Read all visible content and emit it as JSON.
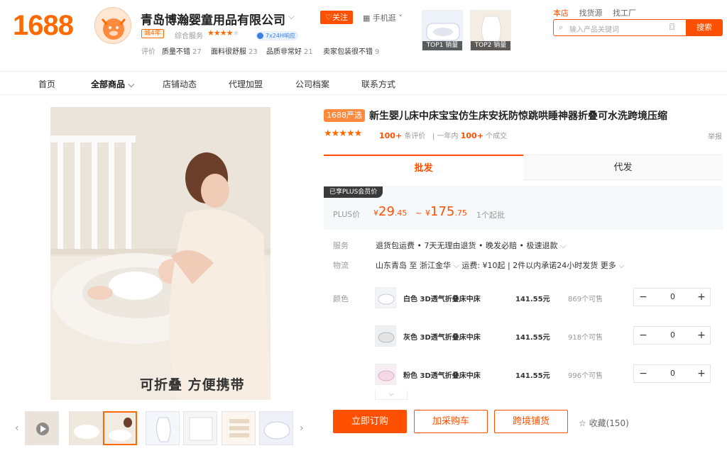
{
  "header": {
    "logo": "1688",
    "shop_name": "青岛博瀚婴童用品有限公司",
    "follow": "关注",
    "mobile": "手机逛",
    "years_badge": "诚4年",
    "service_label": "综合服务",
    "service_rating_stars": 4,
    "response_badge": "7x24H响应",
    "review_label": "评价",
    "review_tags": [
      {
        "label": "质量不错",
        "count": "27"
      },
      {
        "label": "面料很舒服",
        "count": "23"
      },
      {
        "label": "品质非常好",
        "count": "21"
      },
      {
        "label": "卖家包装很不错",
        "count": "9"
      }
    ],
    "top_products": [
      {
        "label": "TOP1 销量"
      },
      {
        "label": "TOP2 销量"
      }
    ],
    "links": [
      "本店",
      "找货源",
      "找工厂"
    ],
    "search_placeholder": "输入产品关键词",
    "search_button": "搜索"
  },
  "nav": {
    "items": [
      "首页",
      "全部商品",
      "店铺动态",
      "代理加盟",
      "公司档案",
      "联系方式"
    ]
  },
  "gallery": {
    "caption": "可折叠 方便携带",
    "thumbnail_count": 7,
    "selected_index": 2
  },
  "product": {
    "badge": "1688严选",
    "title": "新生婴儿床中床宝宝仿生床安抚防惊跳哄睡神器折叠可水洗跨境压缩",
    "review_count": "100+",
    "review_suffix": "条评价",
    "year_prefix": "一年内",
    "deals": "100+",
    "deals_suffix": "个成交",
    "report": "举报",
    "tabs": [
      "批发",
      "代发"
    ],
    "active_tab": 0,
    "plus_tag": "已享PLUS会员价",
    "plus_label": "PLUS价",
    "price_low_int": "29",
    "price_low_dec": ".45",
    "price_high_int": "175",
    "price_high_dec": ".75",
    "currency": "¥",
    "price_sep": "~",
    "moq": "1个起批",
    "service_label": "服务",
    "service_text": "退货包运费 • 7天无理由退货 • 晚发必赔 • 极速退款",
    "logistics_label": "物流",
    "logistics_text": "山东青岛 至 浙江金华",
    "shipping_fee": "运费: ¥10起",
    "shipping_promise": "2件以内承诺24小时发货",
    "more": "更多",
    "color_label": "颜色",
    "skus": [
      {
        "name": "白色 3D透气折叠床中床",
        "price": "141.55元",
        "stock": "869个可售",
        "qty": "0"
      },
      {
        "name": "灰色 3D透气折叠床中床",
        "price": "141.55元",
        "stock": "918个可售",
        "qty": "0"
      },
      {
        "name": "粉色 3D透气折叠床中床",
        "price": "141.55元",
        "stock": "996个可售",
        "qty": "0"
      }
    ],
    "buttons": {
      "buy": "立即订购",
      "cart": "加采购车",
      "crossborder": "跨境铺货",
      "favorite": "收藏(150)"
    }
  },
  "colors": {
    "accent": "#ff5000",
    "brand": "#ff6a00"
  }
}
